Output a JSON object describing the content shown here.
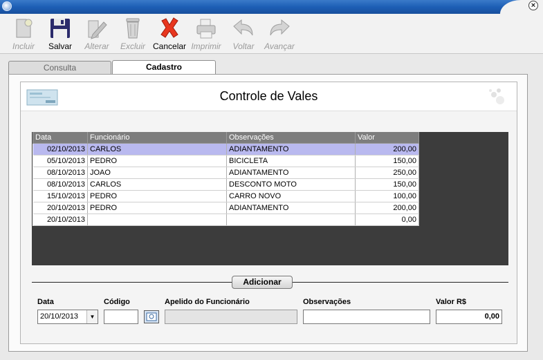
{
  "toolbar": {
    "buttons": [
      {
        "label": "Incluir",
        "icon": "new-document-icon",
        "enabled": false
      },
      {
        "label": "Salvar",
        "icon": "floppy-disk-icon",
        "enabled": true
      },
      {
        "label": "Alterar",
        "icon": "edit-pencil-icon",
        "enabled": false
      },
      {
        "label": "Excluir",
        "icon": "trash-can-icon",
        "enabled": false
      },
      {
        "label": "Cancelar",
        "icon": "red-x-icon",
        "enabled": true
      },
      {
        "label": "Imprimir",
        "icon": "printer-icon",
        "enabled": false
      },
      {
        "label": "Voltar",
        "icon": "back-arrow-icon",
        "enabled": false
      },
      {
        "label": "Avançar",
        "icon": "forward-arrow-icon",
        "enabled": false
      }
    ]
  },
  "tabs": {
    "consulta": "Consulta",
    "cadastro": "Cadastro"
  },
  "header": {
    "title": "Controle de Vales"
  },
  "grid": {
    "columns": [
      "Data",
      "Funcionário",
      "Observações",
      "Valor"
    ],
    "rows": [
      {
        "data": "02/10/2013",
        "funcionario": "CARLOS",
        "obs": "ADIANTAMENTO",
        "valor": "200,00",
        "selected": true
      },
      {
        "data": "05/10/2013",
        "funcionario": "PEDRO",
        "obs": "BICICLETA",
        "valor": "150,00"
      },
      {
        "data": "08/10/2013",
        "funcionario": "JOAO",
        "obs": "ADIANTAMENTO",
        "valor": "250,00"
      },
      {
        "data": "08/10/2013",
        "funcionario": "CARLOS",
        "obs": "DESCONTO MOTO",
        "valor": "150,00"
      },
      {
        "data": "15/10/2013",
        "funcionario": "PEDRO",
        "obs": "CARRO NOVO",
        "valor": "100,00"
      },
      {
        "data": "20/10/2013",
        "funcionario": "PEDRO",
        "obs": "ADIANTAMENTO",
        "valor": "200,00"
      },
      {
        "data": "20/10/2013",
        "funcionario": "",
        "obs": "",
        "valor": "0,00"
      }
    ]
  },
  "form": {
    "add_label": "Adicionar",
    "date_label": "Data",
    "date_value": "20/10/2013",
    "code_label": "Código",
    "code_value": "",
    "name_label": "Apelido do Funcionário",
    "name_value": "",
    "obs_label": "Observações",
    "obs_value": "",
    "value_label": "Valor R$",
    "value_value": "0,00"
  },
  "colors": {
    "titlebar": "#1d5fb5",
    "selected_row": "#b9b9ef",
    "grid_header": "#7d7d7d",
    "grid_background": "#3c3c3c"
  }
}
